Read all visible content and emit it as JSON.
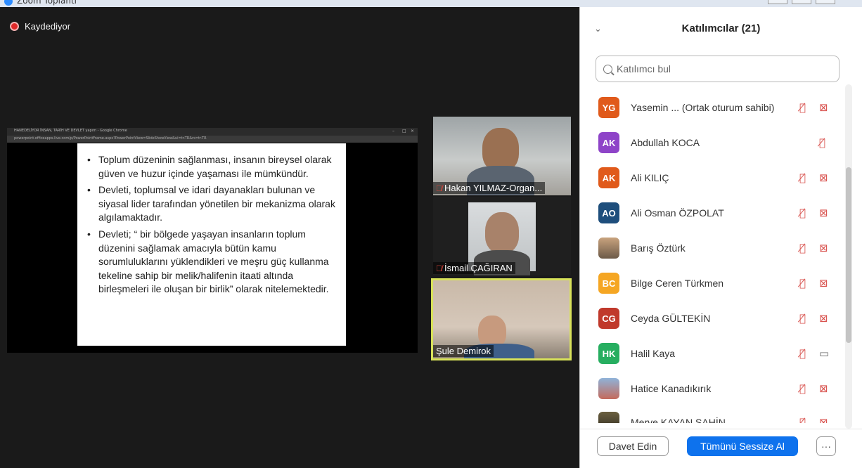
{
  "window": {
    "title": "Zoom Toplantı"
  },
  "recording": {
    "label": "Kaydediyor"
  },
  "share": {
    "browser_title": "HANEDELİYOR İNSAN, TARİH VE DEVLET yapım - Google Chrome",
    "url": "powerpoint.officeapps.live.com/p/PowerPointFrame.aspx?PowerPointView=SlideShowView&ui=tr-TR&rs=tr-TR",
    "slide_bullets": [
      "Toplum düzeninin sağlanması, insanın bireysel olarak güven ve huzur içinde yaşaması ile mümkündür.",
      "Devleti, toplumsal ve idari dayanakları bulunan ve siyasal lider tarafından yönetilen bir mekanizma olarak algılamaktadır.",
      "Devleti; “ bir bölgede yaşayan insanların toplum düzenini sağlamak amacıyla bütün kamu sorumluluklarını yüklendikleri ve meşru güç kullanma tekeline sahip bir melik/halifenin itaati altında birleşmeleri ile oluşan bir birlik” olarak nitelemektedir."
    ]
  },
  "video_tiles": [
    {
      "name": "Hakan YILMAZ-Organ...",
      "muted": true
    },
    {
      "name": "İsmail ÇAĞIRAN",
      "muted": true
    },
    {
      "name": "Şule Demirok",
      "muted": false,
      "active_speaker": true
    }
  ],
  "panel": {
    "title": "Katılımcılar (21)",
    "search_placeholder": "Katılımcı bul",
    "participants": [
      {
        "initials": "YG",
        "color": "#e05a1b",
        "name": "Yasemin ...  (Ortak oturum sahibi)",
        "mic": "muted",
        "cam": "off"
      },
      {
        "initials": "AK",
        "color": "#8e44c8",
        "name": "Abdullah KOCA",
        "mic": "muted",
        "cam": "none"
      },
      {
        "initials": "AK",
        "color": "#e05a1b",
        "name": "Ali KILIÇ",
        "mic": "muted",
        "cam": "off"
      },
      {
        "initials": "AO",
        "color": "#1e4e7c",
        "name": "Ali Osman ÖZPOLAT",
        "mic": "muted",
        "cam": "off"
      },
      {
        "initials": "",
        "color": "#8a7560",
        "name": "Barış Öztürk",
        "mic": "muted",
        "cam": "off",
        "photo": true
      },
      {
        "initials": "BC",
        "color": "#f5a623",
        "name": "Bilge Ceren Türkmen",
        "mic": "muted",
        "cam": "off"
      },
      {
        "initials": "CG",
        "color": "#c0392b",
        "name": "Ceyda GÜLTEKİN",
        "mic": "muted",
        "cam": "off"
      },
      {
        "initials": "HK",
        "color": "#27ae60",
        "name": "Halil Kaya",
        "mic": "muted",
        "cam": "on"
      },
      {
        "initials": "",
        "color": "#6f8fb0",
        "name": "Hatice Kanadıkırık",
        "mic": "muted",
        "cam": "off",
        "photo": true
      },
      {
        "initials": "",
        "color": "#4a4a3a",
        "name": "Merve KAYAN SAHİN",
        "mic": "muted",
        "cam": "off",
        "photo": true
      }
    ],
    "footer": {
      "invite_label": "Davet Edin",
      "mute_all_label": "Tümünü Sessize Al",
      "more_label": "···"
    }
  },
  "icons": {
    "mic_muted": "mic-off-icon",
    "cam_off": "video-off-icon",
    "cam_on": "video-icon",
    "search": "search-icon",
    "collapse": "chevron-down-icon"
  }
}
